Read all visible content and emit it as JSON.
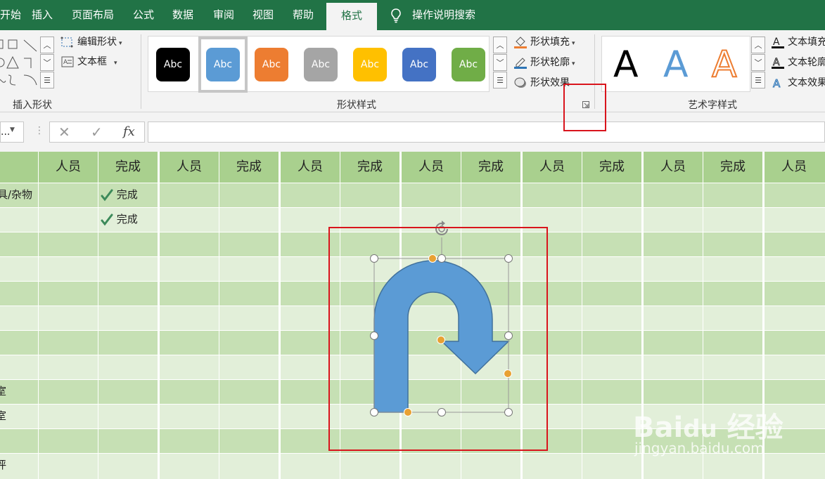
{
  "tabs": [
    {
      "label": "开始"
    },
    {
      "label": "插入"
    },
    {
      "label": "页面布局"
    },
    {
      "label": "公式"
    },
    {
      "label": "数据"
    },
    {
      "label": "审阅"
    },
    {
      "label": "视图"
    },
    {
      "label": "帮助"
    },
    {
      "label": "格式"
    }
  ],
  "search_label": "操作说明搜索",
  "ribbon": {
    "insert_shapes": {
      "edit_shape": "编辑形状",
      "text_box": "文本框",
      "label": "插入形状"
    },
    "shape_styles": {
      "label": "形状样式",
      "swatch_text": "Abc",
      "swatches": [
        {
          "color": "#000000"
        },
        {
          "color": "#5b9bd5"
        },
        {
          "color": "#ed7d31"
        },
        {
          "color": "#a5a5a5"
        },
        {
          "color": "#ffc000"
        },
        {
          "color": "#4472c4"
        },
        {
          "color": "#70ad47"
        }
      ],
      "fill": "形状填充",
      "outline": "形状轮廓",
      "effects": "形状效果"
    },
    "wordart": {
      "label": "艺术字样式",
      "letter": "A",
      "fill": "文本填充",
      "outline": "文本轮廓",
      "effects": "文本效果"
    }
  },
  "formula_bar": {
    "namebox": "...",
    "cancel": "✕",
    "confirm": "✓",
    "fx": "fx"
  },
  "sheet": {
    "headers": [
      "人员",
      "完成",
      "人员",
      "完成",
      "人员",
      "完成",
      "人员",
      "完成",
      "人员",
      "完成",
      "人员",
      "完成",
      "人员"
    ],
    "row_labels": [
      "具/杂物",
      "",
      "",
      "",
      "",
      "",
      "",
      "",
      "室",
      "室",
      "",
      "评"
    ],
    "done_text": "完成"
  },
  "colors": {
    "accent": "#217346",
    "header": "#a9d08e",
    "row_a": "#c6e0b4",
    "row_b": "#e2efd9",
    "shape": "#5b9bd5",
    "highlight": "#d9141c"
  }
}
